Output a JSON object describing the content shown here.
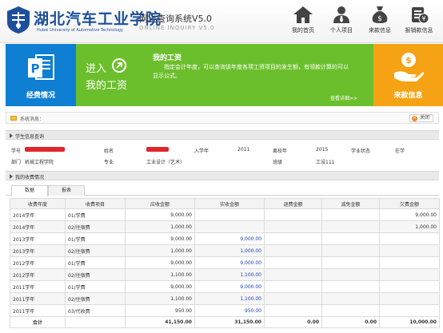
{
  "header": {
    "school_name_cn": "湖北汽车工业学院",
    "school_name_en": "Hubei University of Automotive Technology",
    "system_title": "网上查询系统V5.0",
    "system_title_en": "ONLINE INQUIRY V5.0",
    "nav": [
      {
        "label": "我的首页",
        "icon": "home-icon"
      },
      {
        "label": "个人项目",
        "icon": "person-icon"
      },
      {
        "label": "来款信息",
        "icon": "money-bag-icon"
      },
      {
        "label": "报销款信息",
        "icon": "clipboard-icon"
      }
    ]
  },
  "banner": {
    "left_label": "经费情况",
    "enter": "进入",
    "my_salary": "我的工资",
    "notice_title": "我的工资",
    "notice_text": "指定会计年度，可以查询该年度各项工资项目的发生额，有领款计算的可以显示公式。",
    "detail_link": "查看详细>>",
    "right_label": "来款信息"
  },
  "message_bar": {
    "text": "系统消息：",
    "close_label": "关闭"
  },
  "student_section": {
    "title": "学生信息查询"
  },
  "student_info": {
    "student_id_label": "学号",
    "name_label": "姓名",
    "enroll_year_label": "入学年",
    "enroll_year": "2011",
    "graduate_year_label": "离校年",
    "graduate_year": "2015",
    "status_label": "学业状态",
    "status": "在学",
    "department_label": "部门",
    "department": "机械工程学院",
    "major_label": "专业",
    "major": "工业设计（艺术）",
    "class_label": "班级",
    "class": "工设111"
  },
  "fees_section": {
    "title": "我的收费情况"
  },
  "tabs": [
    {
      "label": "数据",
      "active": true
    },
    {
      "label": "报表",
      "active": false
    }
  ],
  "table": {
    "headers": [
      "收费年度",
      "收费项目",
      "应收金额",
      "实收金额",
      "退费金额",
      "减免金额",
      "欠费金额"
    ],
    "rows": [
      [
        "2014学年",
        "01/学费",
        "9,000.00",
        "",
        "",
        "",
        "9,000.00"
      ],
      [
        "2014学年",
        "02/住宿费",
        "1,000.00",
        "",
        "",
        "",
        "1,000.00"
      ],
      [
        "2013学年",
        "01/学费",
        "9,000.00",
        "9,000.00",
        "",
        "",
        ""
      ],
      [
        "2013学年",
        "02/住宿费",
        "1,000.00",
        "1,000.00",
        "",
        "",
        ""
      ],
      [
        "2012学年",
        "01/学费",
        "9,000.00",
        "9,000.00",
        "",
        "",
        ""
      ],
      [
        "2012学年",
        "02/住宿费",
        "1,100.00",
        "1,100.00",
        "",
        "",
        ""
      ],
      [
        "2011学年",
        "01/学费",
        "9,000.00",
        "9,000.00",
        "",
        "",
        ""
      ],
      [
        "2011学年",
        "02/住宿费",
        "1,100.00",
        "1,100.00",
        "",
        "",
        ""
      ],
      [
        "2011学年",
        "03/代收费",
        "950.00",
        "950.00",
        "",
        "",
        ""
      ]
    ],
    "total": [
      "合计",
      "",
      "41,150.00",
      "31,150.00",
      "0.00",
      "0.00",
      "10,000.00"
    ]
  },
  "colors": {
    "blue_tile": "#0e7fd2",
    "green_tile": "#6cbf2c",
    "orange_tile": "#f5a215",
    "logo_blue": "#1d4f9c",
    "amount_blue": "#1a3fb0"
  }
}
